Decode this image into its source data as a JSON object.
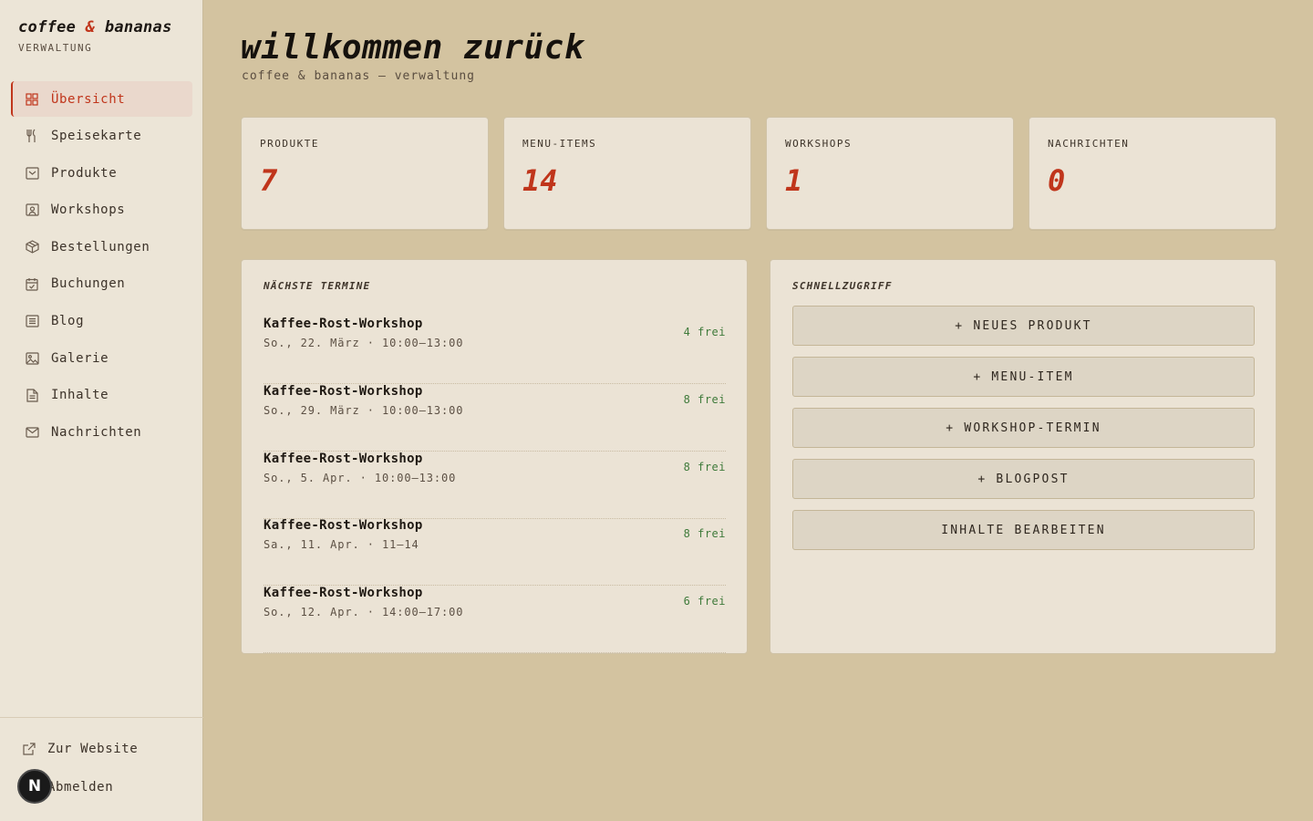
{
  "brand": {
    "name_part1": "coffee",
    "amp": "&",
    "name_part2": "bananas",
    "subtitle": "VERWALTUNG"
  },
  "sidebar": {
    "items": [
      {
        "label": "Übersicht",
        "icon": "grid-icon",
        "active": true
      },
      {
        "label": "Speisekarte",
        "icon": "utensils-icon"
      },
      {
        "label": "Produkte",
        "icon": "box-icon"
      },
      {
        "label": "Workshops",
        "icon": "workshop-icon"
      },
      {
        "label": "Bestellungen",
        "icon": "package-icon"
      },
      {
        "label": "Buchungen",
        "icon": "calendar-check-icon"
      },
      {
        "label": "Blog",
        "icon": "list-icon"
      },
      {
        "label": "Galerie",
        "icon": "image-icon"
      },
      {
        "label": "Inhalte",
        "icon": "file-icon"
      },
      {
        "label": "Nachrichten",
        "icon": "mail-icon"
      }
    ],
    "footer": {
      "website": "Zur Website",
      "logout": "Abmelden"
    },
    "badge": "N"
  },
  "header": {
    "title": "willkommen zurück",
    "subtitle": "coffee & bananas — verwaltung"
  },
  "stats": [
    {
      "label": "PRODUKTE",
      "value": "7"
    },
    {
      "label": "MENU-ITEMS",
      "value": "14"
    },
    {
      "label": "WORKSHOPS",
      "value": "1"
    },
    {
      "label": "NACHRICHTEN",
      "value": "0"
    }
  ],
  "upcoming": {
    "title": "NÄCHSTE TERMINE",
    "events": [
      {
        "name": "Kaffee-Rost-Workshop",
        "date": "So., 22. März · 10:00–13:00",
        "free": "4 frei"
      },
      {
        "name": "Kaffee-Rost-Workshop",
        "date": "So., 29. März · 10:00–13:00",
        "free": "8 frei"
      },
      {
        "name": "Kaffee-Rost-Workshop",
        "date": "So., 5. Apr. · 10:00–13:00",
        "free": "8 frei"
      },
      {
        "name": "Kaffee-Rost-Workshop",
        "date": "Sa., 11. Apr. · 11–14",
        "free": "8 frei"
      },
      {
        "name": "Kaffee-Rost-Workshop",
        "date": "So., 12. Apr. · 14:00–17:00",
        "free": "6 frei"
      }
    ]
  },
  "quick": {
    "title": "SCHNELLZUGRIFF",
    "buttons": [
      "+ NEUES PRODUKT",
      "+ MENU-ITEM",
      "+ WORKSHOP-TERMIN",
      "+ BLOGPOST",
      "INHALTE BEARBEITEN"
    ]
  },
  "colors": {
    "accent": "#c0351b",
    "background": "#d3c3a0",
    "sidebar": "#ece5d7",
    "card": "#ebe3d5",
    "free": "#3e7a3a"
  }
}
